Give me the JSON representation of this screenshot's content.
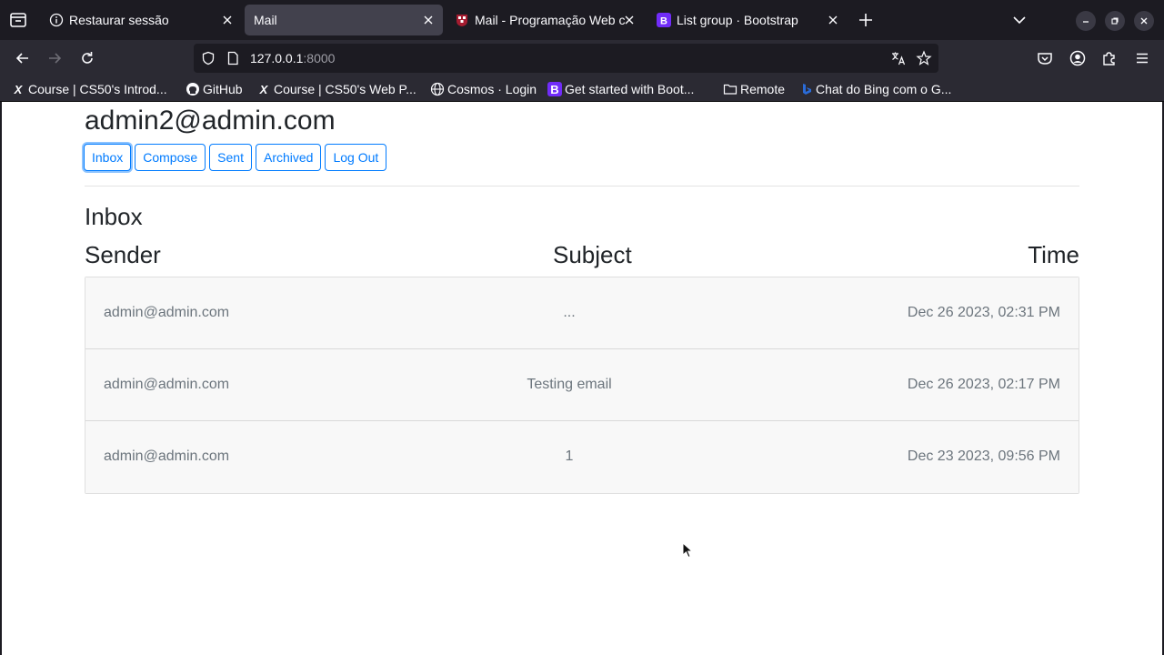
{
  "browser": {
    "tabs": [
      {
        "label": "Restaurar sessão",
        "icon": "info-icon",
        "active": false
      },
      {
        "label": "Mail",
        "icon": "",
        "active": true
      },
      {
        "label": "Mail - Programação Web c",
        "icon": "harvard-icon",
        "active": false
      },
      {
        "label": "List group · Bootstrap",
        "icon": "bootstrap-icon",
        "active": false
      }
    ],
    "url_host": "127.0.0.1",
    "url_port": ":8000",
    "bookmarks": [
      {
        "label": "Course | CS50's Introd...",
        "icon": "edx-icon",
        "glyph": "X"
      },
      {
        "label": "GitHub",
        "icon": "github-icon",
        "glyph": ""
      },
      {
        "label": "Course | CS50's Web P...",
        "icon": "edx-icon",
        "glyph": "X"
      },
      {
        "label": "Cosmos · Login",
        "icon": "globe-icon",
        "glyph": ""
      },
      {
        "label": "Get started with Boot...",
        "icon": "bootstrap-icon",
        "glyph": "B"
      },
      {
        "label": "Remote",
        "icon": "folder-icon",
        "glyph": ""
      },
      {
        "label": "Chat do Bing com o G...",
        "icon": "bing-icon",
        "glyph": ""
      }
    ]
  },
  "page": {
    "user_email": "admin2@admin.com",
    "nav_buttons": [
      "Inbox",
      "Compose",
      "Sent",
      "Archived",
      "Log Out"
    ],
    "view_title": "Inbox",
    "columns": {
      "sender": "Sender",
      "subject": "Subject",
      "time": "Time"
    },
    "emails": [
      {
        "sender": "admin@admin.com",
        "subject": "...",
        "time": "Dec 26 2023, 02:31 PM"
      },
      {
        "sender": "admin@admin.com",
        "subject": "Testing email",
        "time": "Dec 26 2023, 02:17 PM"
      },
      {
        "sender": "admin@admin.com",
        "subject": "1",
        "time": "Dec 23 2023, 09:56 PM"
      }
    ]
  },
  "colors": {
    "accent": "#007bff",
    "chrome_dark": "#1c1b22",
    "toolbar": "#2b2a33",
    "row_bg": "#f8f8f8"
  }
}
